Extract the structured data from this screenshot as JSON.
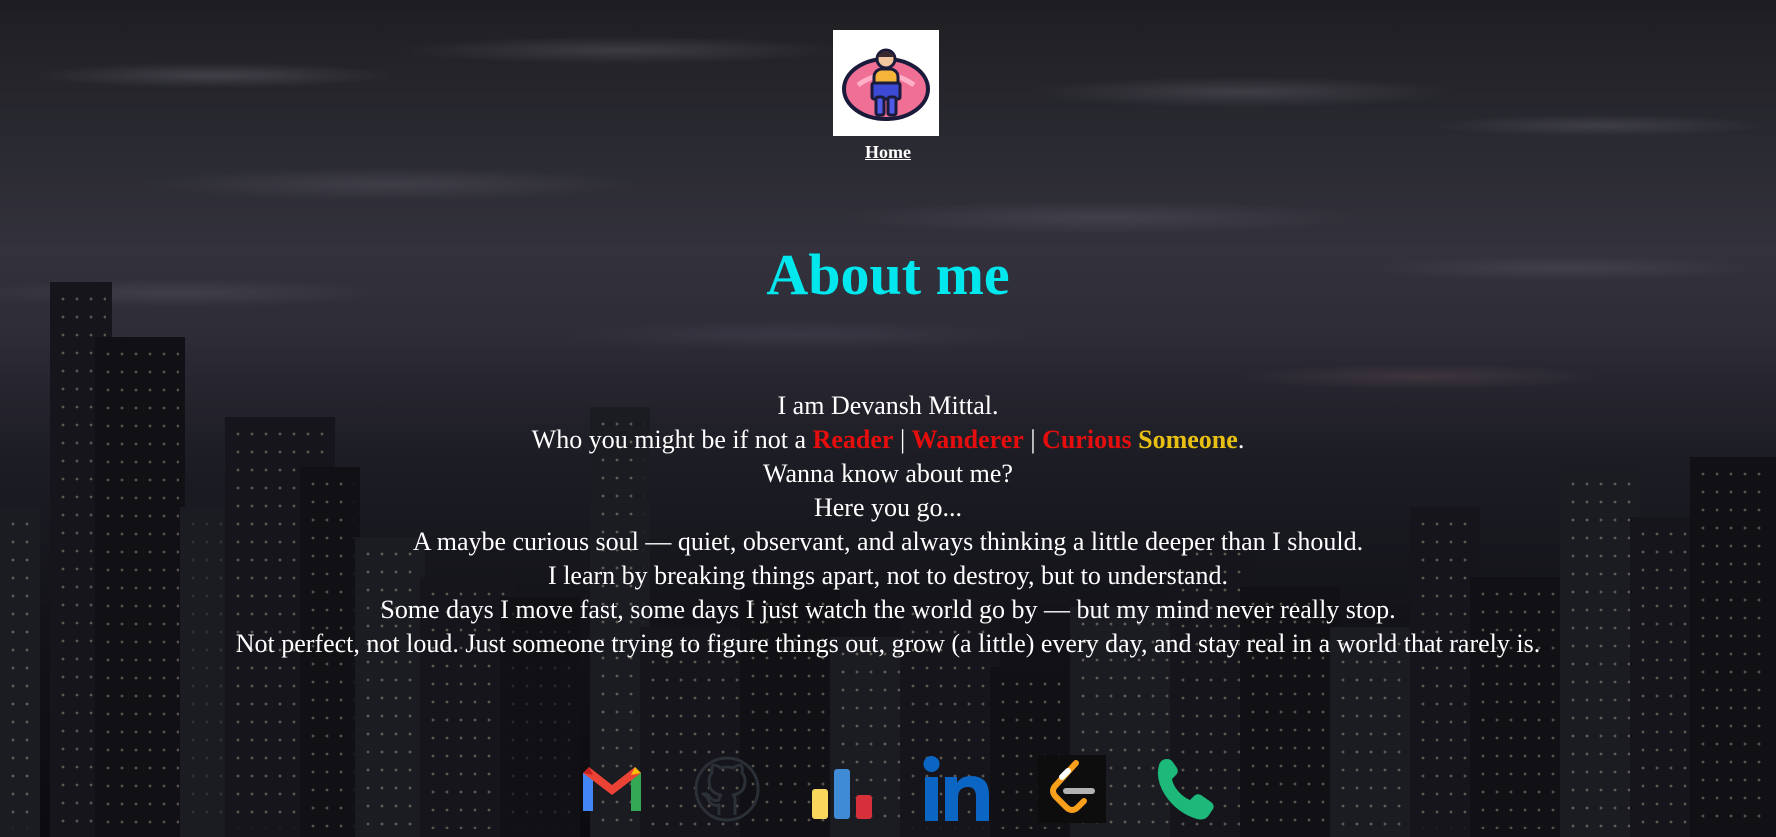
{
  "nav": {
    "logo_icon": "person-on-beanbag-with-laptop-icon",
    "home_label": "Home"
  },
  "page": {
    "title": "About me"
  },
  "about": {
    "line1": "I am Devansh Mittal.",
    "line2_prefix": "Who you might be if not a ",
    "role1": "Reader",
    "sep1": " | ",
    "role2": "Wanderer",
    "sep2": " | ",
    "role3": "Curious",
    "role3_space": " ",
    "role4": "Someone",
    "line2_suffix": ".",
    "line3": "Wanna know about me?",
    "line4": "Here you go...",
    "line5": "A maybe curious soul — quiet, observant, and always thinking a little deeper than I should.",
    "line6": "I learn by breaking things apart, not to destroy, but to understand.",
    "line7": "Some days I move fast, some days I just watch the world go by — but my mind never really stop.",
    "line8": "Not perfect, not loud. Just someone trying to figure things out, grow (a little) every day, and stay real in a world that rarely is."
  },
  "socials": [
    {
      "icon": "gmail-icon"
    },
    {
      "icon": "github-icon"
    },
    {
      "icon": "bar-chart-icon"
    },
    {
      "icon": "linkedin-icon"
    },
    {
      "icon": "leetcode-icon"
    },
    {
      "icon": "phone-icon"
    }
  ],
  "colors": {
    "title": "#00e8ee",
    "accent_red": "#e60d0d",
    "accent_yellow": "#e8c013"
  }
}
